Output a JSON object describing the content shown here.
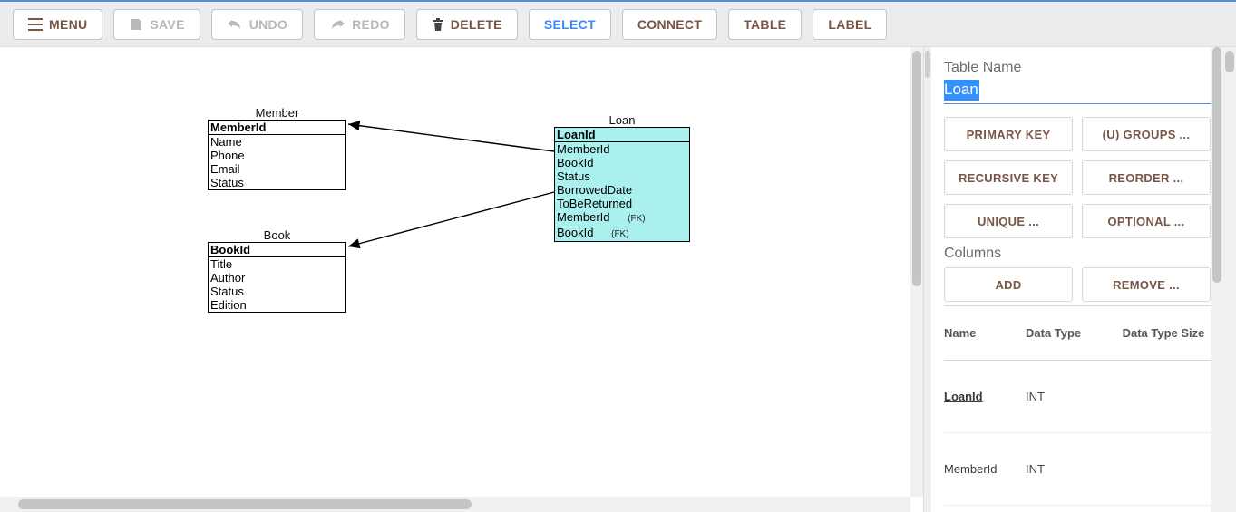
{
  "toolbar": {
    "menu": "MENU",
    "save": "SAVE",
    "undo": "UNDO",
    "redo": "REDO",
    "delete": "DELETE",
    "select": "SELECT",
    "connect": "CONNECT",
    "table": "TABLE",
    "label": "LABEL"
  },
  "entities": {
    "member": {
      "title": "Member",
      "rows": [
        "MemberId",
        "Name",
        "Phone",
        "Email",
        "Status"
      ]
    },
    "book": {
      "title": "Book",
      "rows": [
        "BookId",
        "Title",
        "Author",
        "Status",
        "Edition"
      ]
    },
    "loan": {
      "title": "Loan",
      "rows": [
        "LoanId",
        "MemberId",
        "BookId",
        "Status",
        "BorrowedDate",
        "ToBeReturned",
        "MemberId",
        "BookId"
      ],
      "fk_tag": "(FK)"
    }
  },
  "panel": {
    "table_name_label": "Table Name",
    "table_name_value": "Loan",
    "buttons": {
      "pk": "PRIMARY KEY",
      "ugroups": "(U) GROUPS ...",
      "rk": "RECURSIVE KEY",
      "reorder": "REORDER ...",
      "unique": "UNIQUE ...",
      "optional": "OPTIONAL ..."
    },
    "columns_label": "Columns",
    "add": "ADD",
    "remove": "REMOVE ...",
    "grid_headers": {
      "name": "Name",
      "dt": "Data Type",
      "dts": "Data Type Size"
    },
    "rows": [
      {
        "name": "LoanId",
        "dt": "INT",
        "pk": true
      },
      {
        "name": "MemberId",
        "dt": "INT",
        "pk": false
      }
    ]
  }
}
